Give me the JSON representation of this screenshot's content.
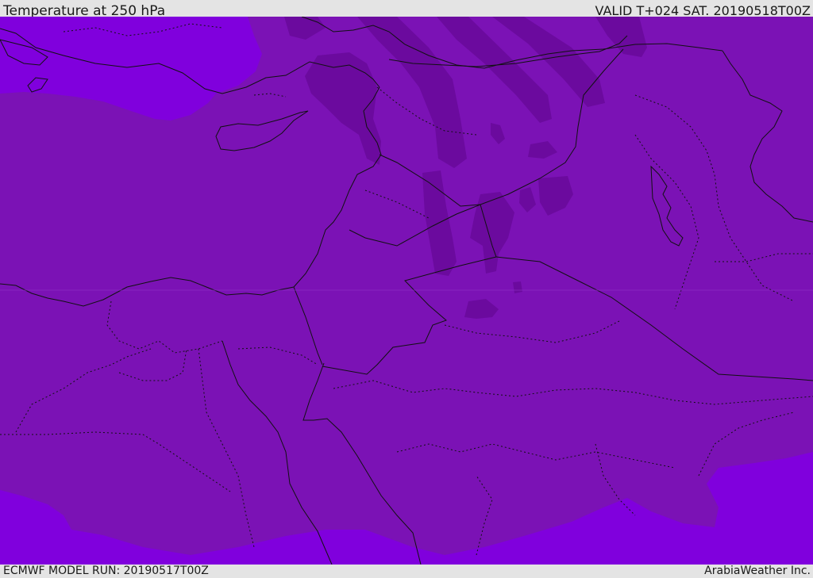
{
  "header": {
    "title": "Temperature at 250 hPa",
    "valid": "VALID T+024 SAT. 20190518T00Z"
  },
  "footer": {
    "model_run": "ECMWF MODEL RUN: 20190517T00Z",
    "credit": "ArabiaWeather Inc."
  },
  "map": {
    "colors": {
      "band_base": "#7b12b5",
      "band_cold": "#6b0a9e",
      "band_warm": "#8000dd",
      "boundary": "#111111"
    }
  }
}
